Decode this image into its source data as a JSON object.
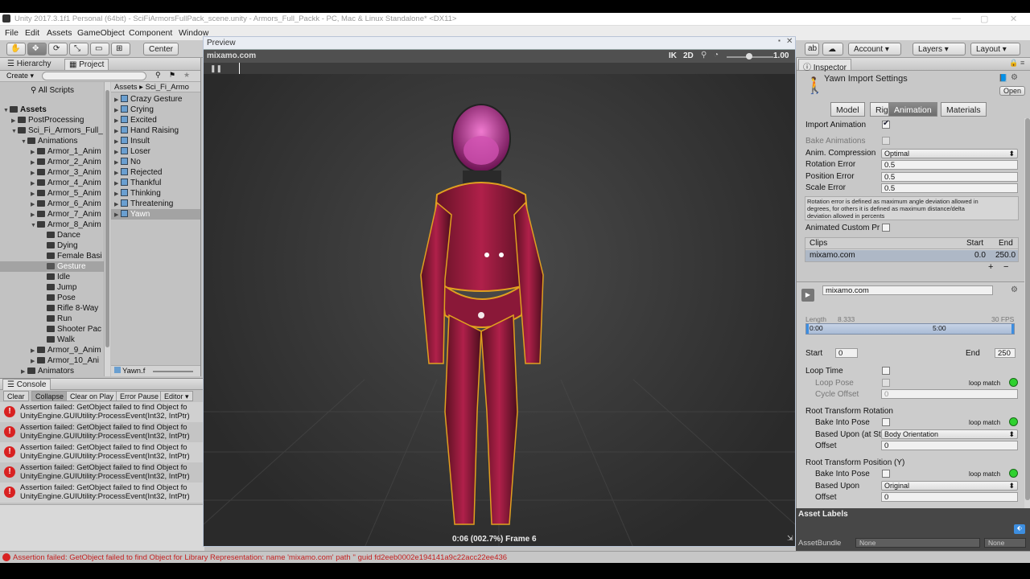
{
  "window": {
    "title": "Unity 2017.3.1f1 Personal (64bit) - SciFiArmorsFullPack_scene.unity - Armors_Full_Packk - PC, Mac & Linux Standalone* <DX11>"
  },
  "menu": [
    "File",
    "Edit",
    "Assets",
    "GameObject",
    "Component",
    "Window",
    "Help"
  ],
  "toolbar": {
    "pivot_mode": "Center",
    "account": "Account",
    "layers": "Layers",
    "layout": "Layout"
  },
  "left_panel": {
    "tabs": [
      "Hierarchy",
      "Project"
    ],
    "create": "Create",
    "all_scripts": "All Scripts",
    "root": "Assets",
    "tree": [
      "PostProcessing",
      "Sci_Fi_Armors_Full_",
      "Animations",
      "Armor_1_Anim",
      "Armor_2_Anim",
      "Armor_3_Anim",
      "Armor_4_Anim",
      "Armor_5_Anim",
      "Armor_6_Anim",
      "Armor_7_Anim",
      "Armor_8_Anim",
      "Dance",
      "Dying",
      "Female Basi",
      "Gesture",
      "Idle",
      "Jump",
      "Pose",
      "Rifle 8-Way",
      "Run",
      "Shooter Pac",
      "Walk",
      "Armor_9_Anim",
      "Armor_10_Ani",
      "Animators"
    ],
    "breadcrumb": [
      "Assets",
      "Sci_Fi_Armo"
    ],
    "files": [
      "Crazy Gesture",
      "Crying",
      "Excited",
      "Hand Raising",
      "Insult",
      "Loser",
      "No",
      "Rejected",
      "Thankful",
      "Thinking",
      "Threatening",
      "Yawn"
    ],
    "selected_file_footer": "Yawn.f"
  },
  "console": {
    "title": "Console",
    "buttons": [
      "Clear",
      "Collapse",
      "Clear on Play",
      "Error Pause",
      "Editor"
    ],
    "logs": [
      {
        "line1": "Assertion failed: GetObject failed to find Object fo",
        "line2": "UnityEngine.GUIUtility:ProcessEvent(Int32, IntPtr)"
      },
      {
        "line1": "Assertion failed: GetObject failed to find Object fo",
        "line2": "UnityEngine.GUIUtility:ProcessEvent(Int32, IntPtr)"
      },
      {
        "line1": "Assertion failed: GetObject failed to find Object fo",
        "line2": "UnityEngine.GUIUtility:ProcessEvent(Int32, IntPtr)"
      },
      {
        "line1": "Assertion failed: GetObject failed to find Object fo",
        "line2": "UnityEngine.GUIUtility:ProcessEvent(Int32, IntPtr)"
      },
      {
        "line1": "Assertion failed: GetObject failed to find Object fo",
        "line2": "UnityEngine.GUIUtility:ProcessEvent(Int32, IntPtr)"
      }
    ]
  },
  "preview": {
    "title": "Preview",
    "clip_name": "mixamo.com",
    "ik": "IK",
    "mode_2d": "2D",
    "speed": "1.00",
    "status": "0:06 (002.7%) Frame 6"
  },
  "inspector": {
    "tab": "Inspector",
    "header": "Yawn Import Settings",
    "open": "Open",
    "tabs": [
      "Model",
      "Rig",
      "Animation",
      "Materials"
    ],
    "active_tab": "Animation",
    "import_animation": "Import Animation",
    "bake_animations": "Bake Animations",
    "anim_compression_label": "Anim. Compression",
    "anim_compression_value": "Optimal",
    "rotation_error_label": "Rotation Error",
    "rotation_error": "0.5",
    "position_error_label": "Position Error",
    "position_error": "0.5",
    "scale_error_label": "Scale Error",
    "scale_error": "0.5",
    "help_line1": "Rotation error is defined as maximum angle deviation allowed in",
    "help_line2": "degrees, for others it is defined as maximum distance/delta",
    "help_line3": "deviation allowed in percents",
    "animated_custom": "Animated Custom Pr",
    "clips_header": "Clips",
    "start_header": "Start",
    "end_header": "End",
    "clip_row_name": "mixamo.com",
    "clip_row_start": "0.0",
    "clip_row_end": "250.0",
    "plus": "+",
    "minus": "−",
    "clip_field": "mixamo.com",
    "length_label": "Length",
    "length_value": "8.333",
    "fps": "30 FPS",
    "timeline_0": "0:00",
    "timeline_1": "5:00",
    "start_label": "Start",
    "start_value": "0",
    "end_label": "End",
    "end_value": "250",
    "loop_time": "Loop Time",
    "loop_pose": "Loop Pose",
    "loop_match": "loop match",
    "cycle_offset": "Cycle Offset",
    "cycle_offset_value": "0",
    "rtr_header": "Root Transform Rotation",
    "bake_into_pose": "Bake Into Pose",
    "based_upon_rot": "Based Upon (at St",
    "based_upon_rot_value": "Body Orientation",
    "offset": "Offset",
    "offset_value": "0",
    "rtp_header": "Root Transform Position (Y)",
    "based_upon": "Based Upon",
    "based_upon_pos_value": "Original",
    "asset_labels": "Asset Labels",
    "asset_bundle": "AssetBundle",
    "none": "None"
  },
  "status_bar": "Assertion failed: GetObject failed to find Object for Library Representation: name 'mixamo.com' path '' guid fd2eeb0002e194141a9c22acc22ee436",
  "colors": {
    "error": "#d82121",
    "accent": "#3d8ee0",
    "green": "#2fd12f",
    "armor": "#b0204a"
  }
}
